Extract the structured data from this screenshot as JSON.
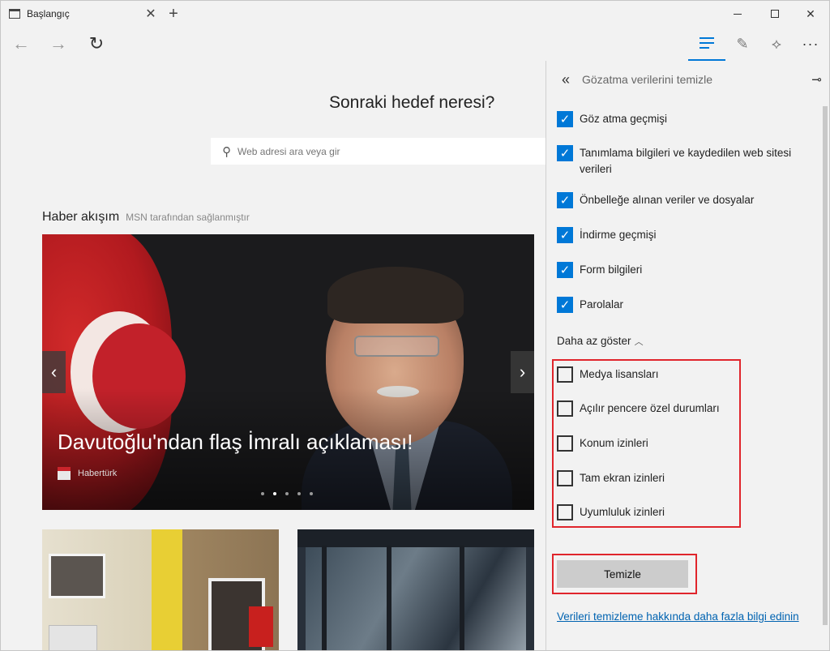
{
  "tab": {
    "title": "Başlangıç"
  },
  "page": {
    "headline": "Sonraki hedef neresi?",
    "search_placeholder": "Web adresi ara veya gir",
    "feed_title": "Haber akışım",
    "feed_source": "MSN tarafından sağlanmıştır",
    "hero": {
      "caption": "Davutoğlu'ndan flaş İmralı açıklaması!",
      "source": "Habertürk",
      "slide_count": 5,
      "active_slide": 2
    }
  },
  "panel": {
    "title": "Gözatma verilerini temizle",
    "checkboxes": [
      {
        "label": "Göz atma geçmişi",
        "checked": true
      },
      {
        "label": "Tanımlama bilgileri ve kaydedilen web sitesi verileri",
        "checked": true
      },
      {
        "label": "Önbelleğe alınan veriler ve dosyalar",
        "checked": true
      },
      {
        "label": "İndirme geçmişi",
        "checked": true
      },
      {
        "label": "Form bilgileri",
        "checked": true
      },
      {
        "label": "Parolalar",
        "checked": true
      },
      {
        "label": "Medya lisansları",
        "checked": false
      },
      {
        "label": "Açılır pencere özel durumları",
        "checked": false
      },
      {
        "label": "Konum izinleri",
        "checked": false
      },
      {
        "label": "Tam ekran izinleri",
        "checked": false
      },
      {
        "label": "Uyumluluk izinleri",
        "checked": false
      }
    ],
    "show_less": "Daha az göster",
    "clear_button": "Temizle",
    "more_info_link": "Verileri temizleme hakkında daha fazla bilgi edinin"
  },
  "colors": {
    "accent": "#0078d7",
    "highlight_box": "#e0252c",
    "link": "#0063b1"
  }
}
